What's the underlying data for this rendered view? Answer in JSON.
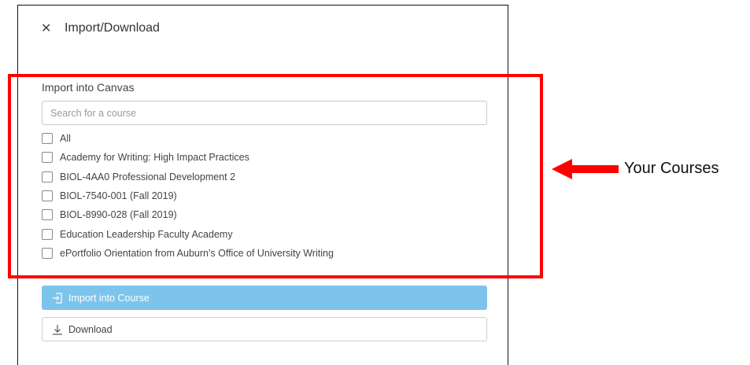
{
  "dialog": {
    "close_glyph": "✕",
    "title": "Import/Download"
  },
  "import_section": {
    "label": "Import into Canvas",
    "search_placeholder": "Search for a course",
    "courses": [
      "All",
      "Academy for Writing: High Impact Practices",
      "BIOL-4AA0 Professional Development 2",
      "BIOL-7540-001 (Fall 2019)",
      "BIOL-8990-028 (Fall 2019)",
      "Education Leadership Faculty Academy",
      "ePortfolio Orientation from Auburn's Office of University Writing"
    ],
    "courses_checked": [
      false,
      false,
      false,
      false,
      false,
      false,
      false
    ]
  },
  "actions": {
    "import_label": "Import into Course",
    "download_label": "Download",
    "import_color": "#7dc4ec"
  },
  "annotation": {
    "text": "Your Courses",
    "color": "#ff0000"
  }
}
